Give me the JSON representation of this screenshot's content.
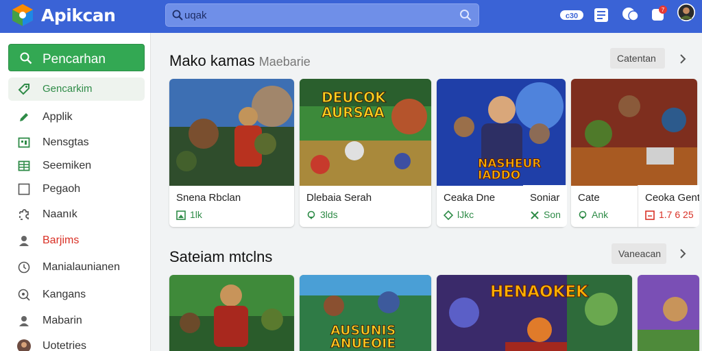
{
  "app": {
    "name": "Apikcan",
    "accent": "#3a63d6",
    "green": "#33a853"
  },
  "search": {
    "value": "uqak"
  },
  "topbar_icons": [
    {
      "icon": "gamepad-icon",
      "text": "c30"
    },
    {
      "icon": "news-icon"
    },
    {
      "icon": "chat-icon"
    },
    {
      "icon": "notifications-icon",
      "badge": "7"
    },
    {
      "icon": "avatar"
    }
  ],
  "sidebar": {
    "search_button": "Pencarhan",
    "items": [
      {
        "label": "Gencarkim",
        "icon": "tag-icon",
        "state": "active"
      },
      {
        "label": "Applik",
        "icon": "pencil-icon"
      },
      {
        "label": "Nensgtas",
        "icon": "grid-icon"
      },
      {
        "label": "Seemiken",
        "icon": "table-icon"
      },
      {
        "label": "Pegaoh",
        "icon": "square-icon"
      },
      {
        "label": "Naanık",
        "icon": "puzzle-icon"
      },
      {
        "label": "Barjims",
        "icon": "person-icon",
        "color": "red"
      },
      {
        "label": "Manialaunianen",
        "icon": "clock-icon"
      },
      {
        "label": "Kangans",
        "icon": "search-circle-icon"
      },
      {
        "label": "Mabarin",
        "icon": "person-icon"
      },
      {
        "label": "Uotetries",
        "icon": "avatar"
      }
    ]
  },
  "section1": {
    "title": "Mako kamas",
    "subtitle": "Maebarie",
    "more_label": "Catentan",
    "cards": [
      {
        "name": "Snena Rbclan",
        "meta": "1lk",
        "meta_icon": "image-icon"
      },
      {
        "name": "Dlebaia Serah",
        "meta": "3lds",
        "meta_icon": "pin-icon",
        "art_title": "DEUCOK AURSAA"
      },
      {
        "name": "Ceaka Dne",
        "meta": "lJkc",
        "meta_icon": "diamond-icon",
        "art_title": "NASHEUR IADDO"
      },
      {
        "name": "Soniar",
        "meta": "Son",
        "meta_icon": "tools-icon"
      },
      {
        "name": "Cate",
        "meta": "Ank",
        "meta_icon": "pin-icon"
      },
      {
        "name": "Ceoka Gent",
        "meta": "1.7 6 25",
        "meta_icon": "gallery-icon",
        "meta_color": "red"
      }
    ]
  },
  "section2": {
    "title": "Sateiam mtclns",
    "more_label": "Vaneacan",
    "cards": [
      {
        "art_title": ""
      },
      {
        "art_title": "AUSUNIS ANUEOIE"
      },
      {
        "art_title": "HENAOKEK"
      },
      {
        "art_title": ""
      }
    ]
  }
}
